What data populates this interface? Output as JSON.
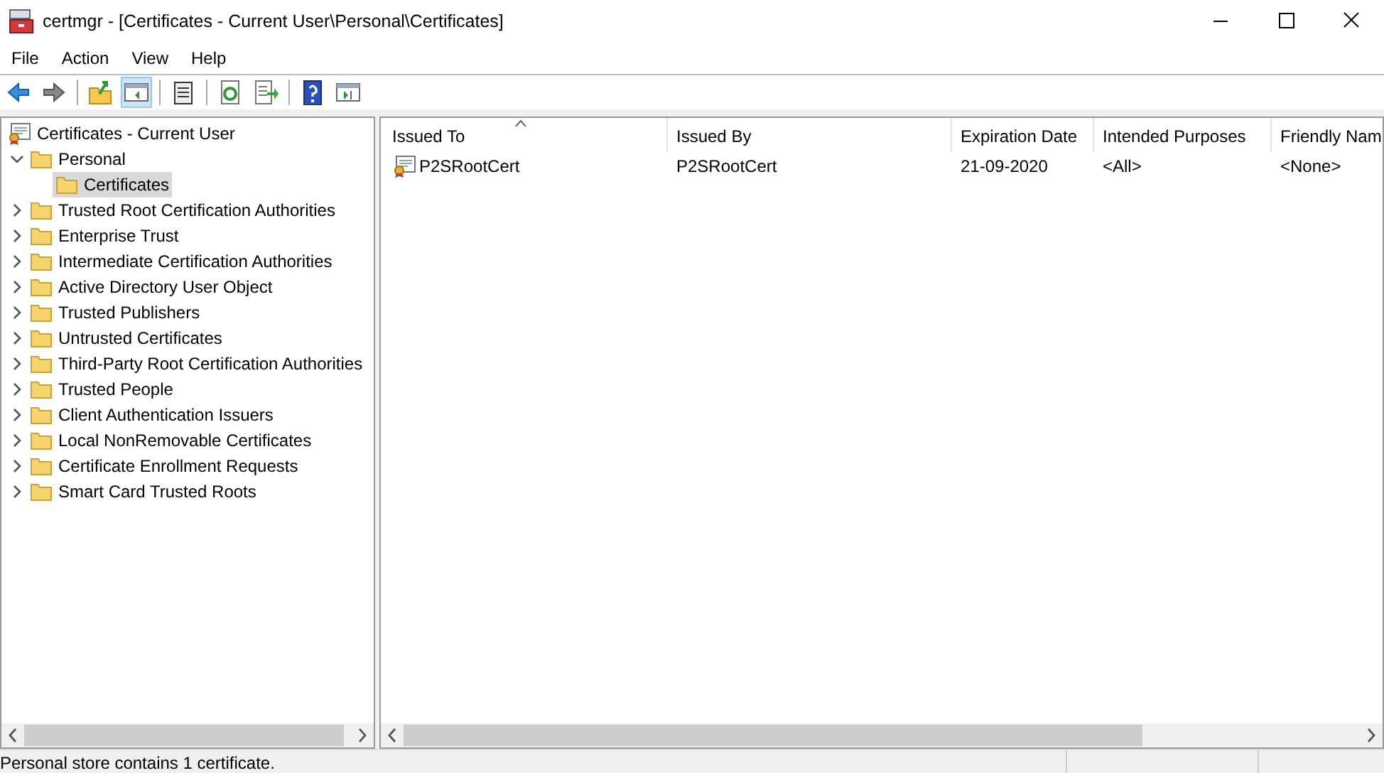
{
  "window": {
    "title": "certmgr - [Certificates - Current User\\Personal\\Certificates]"
  },
  "menu": [
    "File",
    "Action",
    "View",
    "Help"
  ],
  "toolbar": [
    {
      "kind": "back",
      "pressed": false
    },
    {
      "kind": "forward",
      "pressed": false
    },
    {
      "kind": "sep"
    },
    {
      "kind": "up",
      "pressed": false
    },
    {
      "kind": "tree",
      "pressed": true
    },
    {
      "kind": "sep"
    },
    {
      "kind": "clipboard",
      "pressed": false
    },
    {
      "kind": "sep"
    },
    {
      "kind": "refresh",
      "pressed": false
    },
    {
      "kind": "export",
      "pressed": false
    },
    {
      "kind": "sep"
    },
    {
      "kind": "help",
      "pressed": false
    },
    {
      "kind": "pane",
      "pressed": false
    }
  ],
  "tree": {
    "label": "Certificates - Current User",
    "children": [
      {
        "label": "Personal",
        "expanded": true,
        "selected": false,
        "children": [
          {
            "label": "Certificates",
            "selected": true
          }
        ]
      },
      {
        "label": "Trusted Root Certification Authorities",
        "expanded": false,
        "selected": false
      },
      {
        "label": "Enterprise Trust",
        "expanded": false,
        "selected": false
      },
      {
        "label": "Intermediate Certification Authorities",
        "expanded": false,
        "selected": false
      },
      {
        "label": "Active Directory User Object",
        "expanded": false,
        "selected": false
      },
      {
        "label": "Trusted Publishers",
        "expanded": false,
        "selected": false
      },
      {
        "label": "Untrusted Certificates",
        "expanded": false,
        "selected": false
      },
      {
        "label": "Third-Party Root Certification Authorities",
        "expanded": false,
        "selected": false
      },
      {
        "label": "Trusted People",
        "expanded": false,
        "selected": false
      },
      {
        "label": "Client Authentication Issuers",
        "expanded": false,
        "selected": false
      },
      {
        "label": "Local NonRemovable Certificates",
        "expanded": false,
        "selected": false
      },
      {
        "label": "Certificate Enrollment Requests",
        "expanded": false,
        "selected": false
      },
      {
        "label": "Smart Card Trusted Roots",
        "expanded": false,
        "selected": false
      }
    ]
  },
  "table": {
    "columns": [
      {
        "label": "Issued To",
        "sorted": true
      },
      {
        "label": "Issued By",
        "sorted": false
      },
      {
        "label": "Expiration Date",
        "sorted": false
      },
      {
        "label": "Intended Purposes",
        "sorted": false
      },
      {
        "label": "Friendly Nam",
        "sorted": false
      }
    ],
    "rows": [
      [
        "P2SRootCert",
        "P2SRootCert",
        "21-09-2020",
        "<All>",
        "<None>"
      ]
    ]
  },
  "status_bar": "Personal store contains 1 certificate."
}
